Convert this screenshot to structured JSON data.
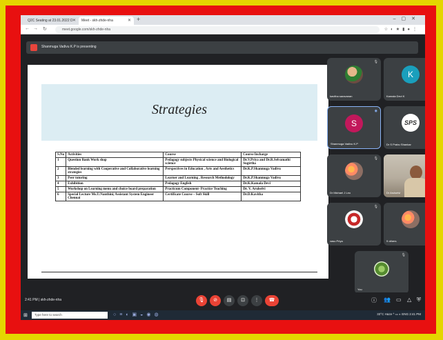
{
  "browser": {
    "tabs": [
      {
        "label": "Q2C Seating at 23.01.2022 D"
      },
      {
        "label": "Meet - skh-zhde-nha"
      }
    ],
    "url": "meet.google.com/skh-zhde-nha"
  },
  "presenting": {
    "text": "Shanmuga Vadivu K.P is presenting"
  },
  "slide": {
    "title": "Strategies",
    "columns": [
      "S.No",
      "Activities",
      "Course",
      "Course Incharge"
    ],
    "rows": [
      [
        "1",
        "Question Bank Work shop",
        "Pedagogy subjects Physical science and Biological science",
        "Dr.V.Priya and Dr.R.Selvamathi Sugirtha"
      ],
      [
        "2",
        "Blended learning with Cooperative and Collaborative learning strategies",
        "Perspectives in Education , Arts and Aesthetics",
        "Dr.K.P.Shanmuga Vadivu"
      ],
      [
        "3",
        "Peer tutoring",
        "Learner and Learning , Research Methodology",
        "Dr.K.P.Shanmuga Vadivu"
      ],
      [
        "4",
        "Exhibition",
        "Pedagogy English",
        "Dr.K.Kamala Devi"
      ],
      [
        "5",
        "Workshop on Learning menu and choice board preparation",
        "Practicum Component- Practice Teaching",
        "Dr. V. Arulselvi"
      ],
      [
        "6",
        "Special Lecture Ms.U.Nanthini, Assistant System Engineer Chennai",
        "Certificate Course – Soft Skill",
        "Dr.D.Kavitha"
      ]
    ]
  },
  "participants": [
    {
      "name": "kavitha saravanan",
      "initial": ""
    },
    {
      "name": "Kamala Devi K",
      "initial": "K",
      "color": "#1a9fbc"
    },
    {
      "name": "Shanmuga Vadivu K.P",
      "initial": "S",
      "color": "#c2185b"
    },
    {
      "name": "Dr S Prabu Shankar",
      "initial": "SPS"
    },
    {
      "name": "Dr Michael J Leo",
      "initial": ""
    },
    {
      "name": "Dr Arulselvi",
      "initial": ""
    },
    {
      "name": "vasu Priya",
      "initial": ""
    },
    {
      "name": "9 others",
      "initial": ""
    },
    {
      "name": "You",
      "initial": ""
    }
  ],
  "meeting": {
    "time": "2:41 PM",
    "separator": "|",
    "code": "skh-zhde-nha"
  },
  "taskbar": {
    "search_placeholder": "Type here to search",
    "tray_text": "33°C Haze",
    "clock": "2:41 PM",
    "date": "23-01-2022",
    "lang": "ENG"
  },
  "colors": {
    "accent": "#8ab4f8",
    "end_call": "#ea4335",
    "frame_outer": "#e4d600",
    "frame_inner": "#e81010"
  }
}
